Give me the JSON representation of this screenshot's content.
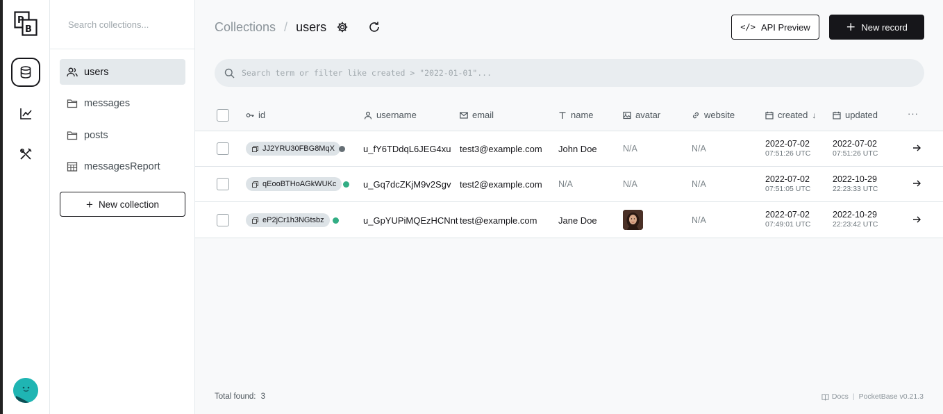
{
  "sidebar": {
    "search_placeholder": "Search collections...",
    "collections": [
      {
        "label": "users",
        "icon": "users-icon",
        "active": true
      },
      {
        "label": "messages",
        "icon": "folder-icon",
        "active": false
      },
      {
        "label": "posts",
        "icon": "folder-icon",
        "active": false
      },
      {
        "label": "messagesReport",
        "icon": "table-icon",
        "active": false
      }
    ],
    "new_collection_label": "New collection"
  },
  "header": {
    "breadcrumb_root": "Collections",
    "breadcrumb_sep": "/",
    "breadcrumb_current": "users",
    "api_preview_label": "API Preview",
    "api_preview_icon": "</>",
    "new_record_label": "New record",
    "new_record_icon": "+"
  },
  "search": {
    "placeholder": "Search term or filter like created > \"2022-01-01\"..."
  },
  "table": {
    "columns": {
      "id": "id",
      "username": "username",
      "email": "email",
      "name": "name",
      "avatar": "avatar",
      "website": "website",
      "created": "created",
      "updated": "updated",
      "more": "···"
    },
    "rows": [
      {
        "id": "JJ2YRU30FBG8MqX",
        "verified": false,
        "username": "u_fY6TDdqL6JEG4xu",
        "email": "test3@example.com",
        "name": "John Doe",
        "avatar": "N/A",
        "website": "N/A",
        "created_date": "2022-07-02",
        "created_time": "07:51:26 UTC",
        "updated_date": "2022-07-02",
        "updated_time": "07:51:26 UTC"
      },
      {
        "id": "qEooBTHoAGkWUKc",
        "verified": true,
        "username": "u_Gq7dcZKjM9v2Sgv",
        "email": "test2@example.com",
        "name": "N/A",
        "avatar": "N/A",
        "website": "N/A",
        "created_date": "2022-07-02",
        "created_time": "07:51:05 UTC",
        "updated_date": "2022-10-29",
        "updated_time": "22:23:33 UTC"
      },
      {
        "id": "eP2jCr1h3NGtsbz",
        "verified": true,
        "username": "u_GpYUPiMQEzHCNnt",
        "email": "test@example.com",
        "name": "Jane Doe",
        "avatar": "image",
        "website": "N/A",
        "created_date": "2022-07-02",
        "created_time": "07:49:01 UTC",
        "updated_date": "2022-10-29",
        "updated_time": "22:23:42 UTC"
      }
    ]
  },
  "footer": {
    "total_label": "Total found:",
    "total_count": "3",
    "docs_label": "Docs",
    "separator": "|",
    "version": "PocketBase v0.21.3"
  },
  "colors": {
    "accent_dark": "#16161a",
    "verified_green": "#32ad84",
    "unverified_gray": "#666f75",
    "logo_teal": "#1fb5b3"
  }
}
